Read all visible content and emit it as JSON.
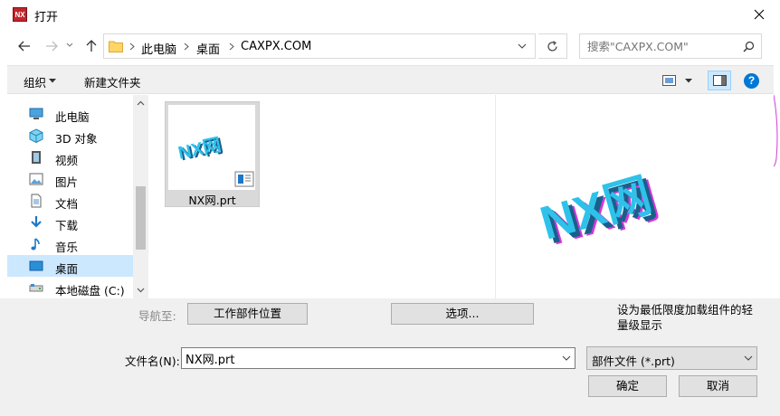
{
  "window": {
    "title": "打开",
    "app_icon_text": "NX"
  },
  "nav": {
    "breadcrumb": [
      "此电脑",
      "桌面",
      "CAXPX.COM"
    ],
    "search_placeholder": "搜索\"CAXPX.COM\""
  },
  "toolbar": {
    "organize_label": "组织",
    "new_folder_label": "新建文件夹"
  },
  "sidebar": {
    "items": [
      {
        "label": "此电脑",
        "icon": "computer-icon"
      },
      {
        "label": "3D 对象",
        "icon": "cube-3d-icon"
      },
      {
        "label": "视频",
        "icon": "video-icon"
      },
      {
        "label": "图片",
        "icon": "picture-icon"
      },
      {
        "label": "文档",
        "icon": "document-icon"
      },
      {
        "label": "下载",
        "icon": "download-icon"
      },
      {
        "label": "音乐",
        "icon": "music-icon"
      },
      {
        "label": "桌面",
        "icon": "desktop-icon",
        "selected": true
      },
      {
        "label": "本地磁盘 (C:)",
        "icon": "drive-icon"
      }
    ]
  },
  "files": [
    {
      "name": "NX网.prt",
      "thumb_text": "NX网"
    }
  ],
  "preview": {
    "text": "NX网"
  },
  "bottom": {
    "navigate_label": "导航至:",
    "work_part_location_label": "工作部件位置",
    "options_label": "选项...",
    "lightweight_note": "设为最低限度加载组件的轻量级显示",
    "filename_label": "文件名(N):",
    "filename_value": "NX网.prt",
    "filetype_value": "部件文件 (*.prt)",
    "ok_label": "确定",
    "cancel_label": "取消"
  },
  "colors": {
    "selection": "#cce8ff",
    "accent_blue": "#0078d7",
    "nx_red": "#c0262d",
    "text_3d_face": "#2ec2ea",
    "text_3d_side": "#1a5f8c"
  }
}
